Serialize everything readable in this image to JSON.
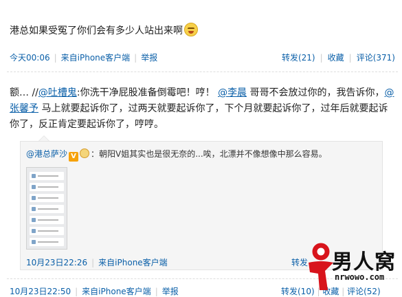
{
  "post1": {
    "text": "港总如果受冤了你们会有多少人站出来啊",
    "time": "今天00:06",
    "source": "来自iPhone客户端",
    "report": "举报",
    "forward": "转发(21)",
    "favorite": "收藏",
    "comment": "评论(371)"
  },
  "post2": {
    "prefix": "额… //",
    "mention1": "@吐槽鬼",
    "t1": ":你洗干净屁股准备倒霉吧！哼！",
    "mention2": "@李晨",
    "t2": " 哥哥不会放过你的，我告诉你，",
    "mention3": "@张馨予",
    "t3": " 马上就要起诉你了，过两天就要起诉你了，下个月就要起诉你了，过年后就要起诉你了，反正肯定要起诉你了，哼哼。"
  },
  "quote": {
    "author": "@港总萨沙",
    "vbadge": "V",
    "text": "：朝阳V姐其实也是很无奈的...唉，北漂并不像想像中那么容易。",
    "time": "10月23日22:26",
    "source": "来自iPhone客户端",
    "forward": "转发"
  },
  "bottom": {
    "time": "10月23日22:50",
    "source": "来自iPhone客户端",
    "report": "举报",
    "forward": "转发(10)",
    "favorite": "收藏",
    "comment": "评论(52)"
  },
  "watermark": {
    "name": "男人窝",
    "url": "nrwowo.com"
  },
  "colors": {
    "link": "#0a5fa8",
    "meta": "#999999",
    "logo_red": "#d8141c"
  },
  "icons": [
    "grimace-emoji-icon",
    "vip-v-badge-icon",
    "medal-icon"
  ]
}
